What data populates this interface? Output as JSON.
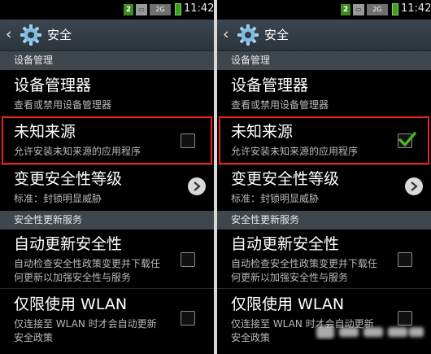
{
  "status_bar": {
    "sim_label": "2",
    "network_label": "2G",
    "time": "11:42"
  },
  "header": {
    "title": "安全",
    "back_icon": "chevron-left-icon",
    "settings_icon": "gear-icon"
  },
  "screens": [
    {
      "section_device": "设备管理",
      "device_admin": {
        "title": "设备管理器",
        "summary": "查看或禁用设备管理器"
      },
      "unknown_sources": {
        "title": "未知来源",
        "summary": "允许安装未知来源的应用程序",
        "checked": false
      },
      "security_level": {
        "title": "变更安全性等级",
        "summary": "标准：封锁明显威胁"
      },
      "section_update": "安全性更新服务",
      "auto_update": {
        "title": "自动更新安全性",
        "summary_line1": "自动检查安全性政策变更并下载任",
        "summary_line2": "何更新以加强安全性与服务",
        "checked": false
      },
      "wlan_only": {
        "title": "仅限使用 WLAN",
        "summary_line1": "仅连接至 WLAN 时才会自动更新",
        "summary_line2": "安全政策",
        "checked": false
      }
    },
    {
      "section_device": "设备管理",
      "device_admin": {
        "title": "设备管理器",
        "summary": "查看或禁用设备管理器"
      },
      "unknown_sources": {
        "title": "未知来源",
        "summary": "允许安装未知来源的应用程序",
        "checked": true
      },
      "security_level": {
        "title": "变更安全性等级",
        "summary": "标准：封锁明显威胁"
      },
      "section_update": "安全性更新服务",
      "auto_update": {
        "title": "自动更新安全性",
        "summary_line1": "自动检查安全性政策变更并下载任",
        "summary_line2": "何更新以加强安全性与服务",
        "checked": false
      },
      "wlan_only": {
        "title": "仅限使用 WLAN",
        "summary_line1": "仅连接至 WLAN 时才会自动更新",
        "summary_line2": "安全政策",
        "checked": false
      }
    }
  ],
  "colors": {
    "highlight_border": "#e8211a",
    "check_mark": "#49b424",
    "section_bg": "#3f474e",
    "actionbar_bg": "#343d45"
  }
}
